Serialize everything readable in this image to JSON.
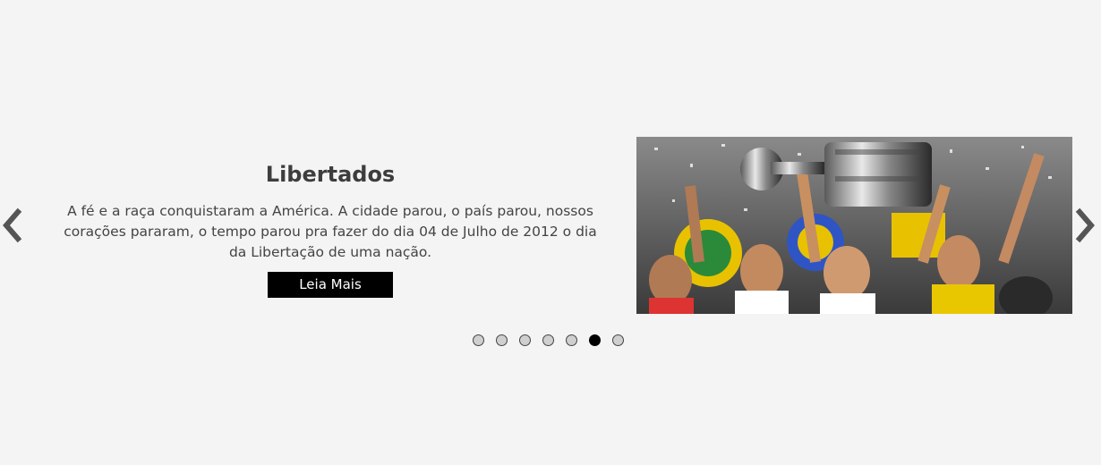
{
  "slide": {
    "title": "Libertados",
    "description": "A fé e a raça conquistaram a América. A cidade parou, o país parou, nossos corações pararam, o tempo parou pra fazer do dia 04 de Julho de 2012 o dia da Libertação de uma nação.",
    "button_label": "Leia Mais"
  },
  "navigation": {
    "prev_icon": "chevron-left-icon",
    "next_icon": "chevron-right-icon"
  },
  "pagination": {
    "total": 7,
    "active_index": 5
  },
  "colors": {
    "background": "#f4f4f4",
    "button": "#000000",
    "arrow": "#555555",
    "dot_active": "#000000",
    "dot_inactive": "#cfcfcf"
  }
}
